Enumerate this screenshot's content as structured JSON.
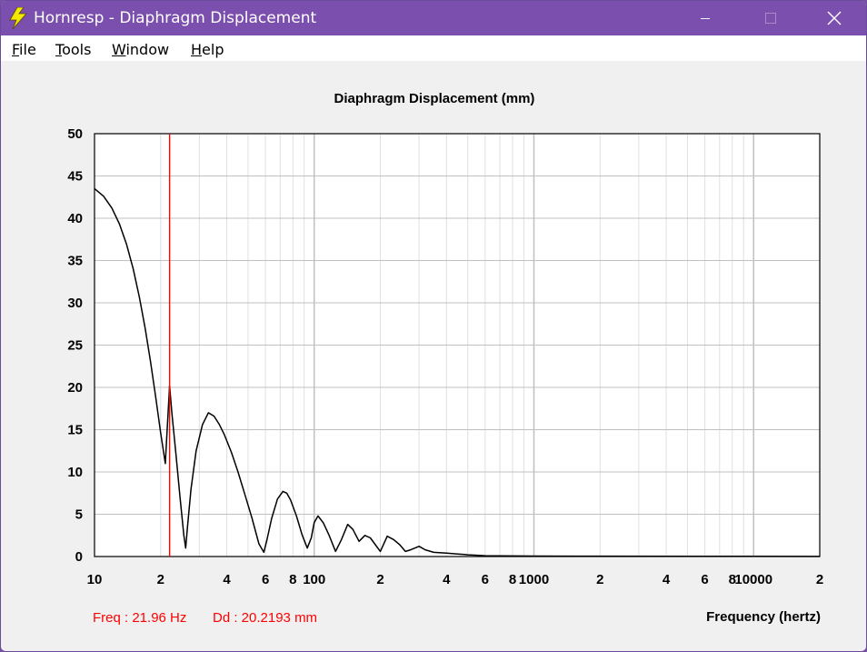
{
  "window": {
    "title": "Hornresp - Diaphragm Displacement",
    "icon": "lightning-bolt-icon",
    "buttons": [
      "minimize-icon",
      "maximize-icon",
      "close-icon"
    ]
  },
  "menu": {
    "items": [
      {
        "label": "File",
        "underline": "F"
      },
      {
        "label": "Tools",
        "underline": "T"
      },
      {
        "label": "Window",
        "underline": "W"
      },
      {
        "label": "Help",
        "underline": "H"
      }
    ]
  },
  "colors": {
    "titlebar": "#7a4fad",
    "curve": "#000000",
    "cursor": "#ff0000",
    "grid_major": "#c0c0c0",
    "grid_minor": "#e0e0e0",
    "readout": "#ff0000"
  },
  "readout": {
    "freq": "Freq : 21.96 Hz",
    "dd": "Dd : 20.2193 mm"
  },
  "chart_data": {
    "type": "line",
    "title": "Diaphragm Displacement (mm)",
    "xlabel": "Frequency (hertz)",
    "ylabel": "",
    "x_scale": "log",
    "xlim": [
      10,
      20000
    ],
    "ylim": [
      0,
      50
    ],
    "y_ticks": [
      0,
      5,
      10,
      15,
      20,
      25,
      30,
      35,
      40,
      45,
      50
    ],
    "x_tick_labels": [
      {
        "x": 10,
        "label": "10"
      },
      {
        "x": 20,
        "label": "2"
      },
      {
        "x": 40,
        "label": "4"
      },
      {
        "x": 60,
        "label": "6"
      },
      {
        "x": 80,
        "label": "8"
      },
      {
        "x": 100,
        "label": "100"
      },
      {
        "x": 200,
        "label": "2"
      },
      {
        "x": 400,
        "label": "4"
      },
      {
        "x": 600,
        "label": "6"
      },
      {
        "x": 800,
        "label": "8"
      },
      {
        "x": 1000,
        "label": "1000"
      },
      {
        "x": 2000,
        "label": "2"
      },
      {
        "x": 4000,
        "label": "4"
      },
      {
        "x": 6000,
        "label": "6"
      },
      {
        "x": 8000,
        "label": "8"
      },
      {
        "x": 10000,
        "label": "10000"
      },
      {
        "x": 20000,
        "label": "2"
      }
    ],
    "grid": true,
    "cursor_x": 21.96,
    "series": [
      {
        "x": [
          10,
          11,
          12,
          13,
          14,
          15,
          16,
          17,
          18,
          19,
          20,
          21,
          21.96,
          22.5,
          23.5,
          24.5,
          25.5,
          26,
          26.5,
          27.5,
          29,
          31,
          33,
          35,
          37,
          39,
          42,
          45,
          48,
          52,
          56,
          59,
          61,
          64,
          68,
          72,
          75,
          78,
          83,
          88,
          93,
          97,
          100,
          104,
          110,
          117,
          125,
          133,
          142,
          150,
          160,
          170,
          180,
          200,
          215,
          230,
          245,
          260,
          275,
          300,
          320,
          350,
          400,
          450,
          500,
          550,
          600,
          700,
          1000,
          2000,
          5000,
          10000,
          20000
        ],
        "y": [
          43.5,
          42.6,
          41.2,
          39.3,
          36.9,
          34.0,
          30.7,
          27.0,
          23.0,
          18.8,
          14.6,
          11.0,
          20.2,
          17.0,
          12.0,
          7.0,
          2.5,
          1.0,
          3.5,
          8.0,
          12.5,
          15.6,
          17.0,
          16.6,
          15.6,
          14.4,
          12.3,
          10.0,
          7.6,
          4.6,
          1.5,
          0.5,
          2.0,
          4.5,
          6.8,
          7.7,
          7.5,
          6.7,
          4.8,
          2.6,
          1.0,
          2.2,
          4.0,
          4.8,
          4.0,
          2.5,
          0.6,
          2.0,
          3.8,
          3.2,
          1.8,
          2.5,
          2.2,
          0.6,
          2.4,
          2.0,
          1.4,
          0.6,
          0.8,
          1.2,
          0.8,
          0.5,
          0.4,
          0.3,
          0.2,
          0.15,
          0.1,
          0.08,
          0.05,
          0.04,
          0.03,
          0.02,
          0.01
        ]
      }
    ]
  }
}
